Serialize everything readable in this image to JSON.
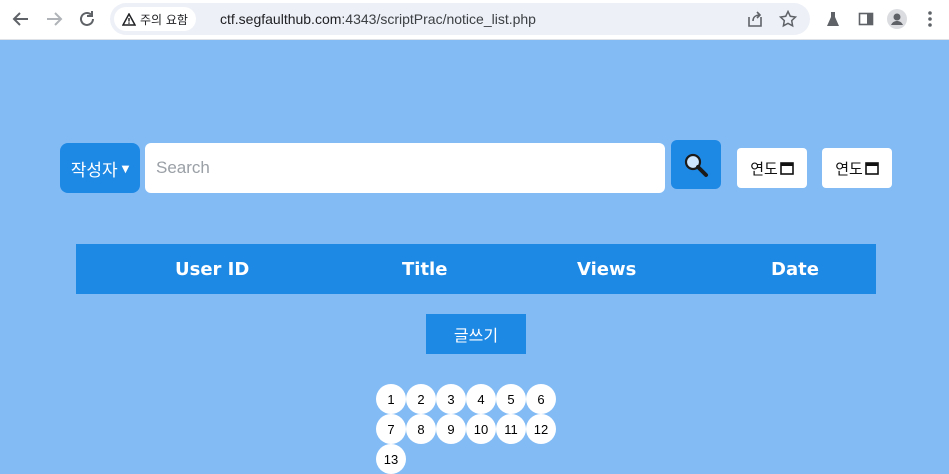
{
  "browser": {
    "security_label": "주의 요함",
    "url_host": "ctf.segfaulthub.com",
    "url_rest": ":4343/scriptPrac/notice_list.php"
  },
  "search": {
    "field_select": "작성자",
    "placeholder": "Search",
    "date_from_label": "연도",
    "date_to_label": "연도"
  },
  "table": {
    "headers": [
      "User ID",
      "Title",
      "Views",
      "Date"
    ]
  },
  "write_button": "글쓰기",
  "pagination": [
    "1",
    "2",
    "3",
    "4",
    "5",
    "6",
    "7",
    "8",
    "9",
    "10",
    "11",
    "12",
    "13"
  ],
  "colors": {
    "page_bg": "#83bcf5",
    "accent": "#1e88e5"
  }
}
